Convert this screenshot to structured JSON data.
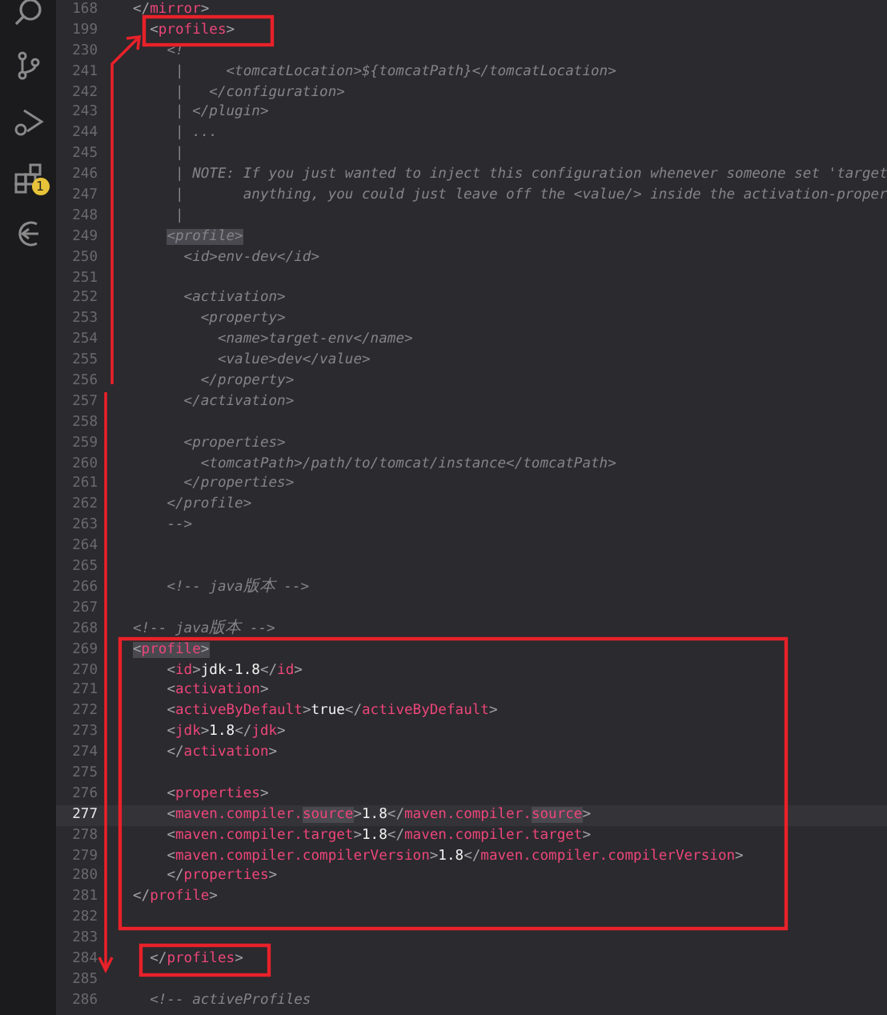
{
  "activity_bar": {
    "items": [
      {
        "kind": "search"
      },
      {
        "kind": "branch"
      },
      {
        "kind": "run"
      },
      {
        "kind": "extensions",
        "badge_text": "1"
      },
      {
        "kind": "arc"
      }
    ]
  },
  "editor": {
    "lines": [
      {
        "number": "168",
        "current": false,
        "segments": [
          {
            "kind": "bracket",
            "text": "</"
          },
          {
            "kind": "tag",
            "text": "mirror"
          },
          {
            "kind": "bracket",
            "text": ">"
          }
        ]
      },
      {
        "number": "199",
        "current": false,
        "segments": [
          {
            "kind": "bracket",
            "text": "  <"
          },
          {
            "kind": "tag",
            "text": "profiles"
          },
          {
            "kind": "bracket",
            "text": ">"
          }
        ]
      },
      {
        "number": "230",
        "current": false,
        "segments": [
          {
            "kind": "comment",
            "text": "    <!"
          }
        ]
      },
      {
        "number": "241",
        "current": false,
        "segments": [
          {
            "kind": "comment",
            "text": "     |     <tomcatLocation>${tomcatPath}</tomcatLocation>"
          }
        ]
      },
      {
        "number": "242",
        "current": false,
        "segments": [
          {
            "kind": "comment",
            "text": "     |   </configuration>"
          }
        ]
      },
      {
        "number": "243",
        "current": false,
        "segments": [
          {
            "kind": "comment",
            "text": "     | </plugin>"
          }
        ]
      },
      {
        "number": "244",
        "current": false,
        "segments": [
          {
            "kind": "comment",
            "text": "     | ..."
          }
        ]
      },
      {
        "number": "245",
        "current": false,
        "segments": [
          {
            "kind": "comment",
            "text": "     |"
          }
        ]
      },
      {
        "number": "246",
        "current": false,
        "segments": [
          {
            "kind": "comment",
            "text": "     | NOTE: If you just wanted to inject this configuration whenever someone set 'target"
          }
        ]
      },
      {
        "number": "247",
        "current": false,
        "segments": [
          {
            "kind": "comment",
            "text": "     |       anything, you could just leave off the <value/> inside the activation-proper"
          }
        ]
      },
      {
        "number": "248",
        "current": false,
        "segments": [
          {
            "kind": "comment",
            "text": "     |"
          }
        ]
      },
      {
        "number": "249",
        "current": false,
        "segments": [
          {
            "kind": "comment-match",
            "text": "    <profile>"
          }
        ]
      },
      {
        "number": "250",
        "current": false,
        "segments": [
          {
            "kind": "comment",
            "text": "      <id>env-dev</id>"
          }
        ]
      },
      {
        "number": "251",
        "current": false
      },
      {
        "number": "252",
        "current": false,
        "segments": [
          {
            "kind": "comment",
            "text": "      <activation>"
          }
        ]
      },
      {
        "number": "253",
        "current": false,
        "segments": [
          {
            "kind": "comment",
            "text": "        <property>"
          }
        ]
      },
      {
        "number": "254",
        "current": false,
        "segments": [
          {
            "kind": "comment",
            "text": "          <name>target-env</name>"
          }
        ]
      },
      {
        "number": "255",
        "current": false,
        "segments": [
          {
            "kind": "comment",
            "text": "          <value>dev</value>"
          }
        ]
      },
      {
        "number": "256",
        "current": false,
        "segments": [
          {
            "kind": "comment",
            "text": "        </property>"
          }
        ]
      },
      {
        "number": "257",
        "current": false,
        "segments": [
          {
            "kind": "comment",
            "text": "      </activation>"
          }
        ]
      },
      {
        "number": "258",
        "current": false
      },
      {
        "number": "259",
        "current": false,
        "segments": [
          {
            "kind": "comment",
            "text": "      <properties>"
          }
        ]
      },
      {
        "number": "260",
        "current": false,
        "segments": [
          {
            "kind": "comment",
            "text": "        <tomcatPath>/path/to/tomcat/instance</tomcatPath>"
          }
        ]
      },
      {
        "number": "261",
        "current": false,
        "segments": [
          {
            "kind": "comment",
            "text": "      </properties>"
          }
        ]
      },
      {
        "number": "262",
        "current": false,
        "segments": [
          {
            "kind": "comment",
            "text": "    </profile>"
          }
        ]
      },
      {
        "number": "263",
        "current": false,
        "segments": [
          {
            "kind": "comment",
            "text": "    -->"
          }
        ]
      },
      {
        "number": "264",
        "current": false
      },
      {
        "number": "265",
        "current": false
      },
      {
        "number": "266",
        "current": false,
        "segments": [
          {
            "kind": "comment",
            "text": "    <!-- java"
          },
          {
            "kind": "comment-cjk",
            "text": "版本"
          },
          {
            "kind": "comment",
            "text": " -->"
          }
        ]
      },
      {
        "number": "267",
        "current": false
      },
      {
        "number": "268",
        "current": false,
        "segments": [
          {
            "kind": "comment",
            "text": "<!-- java"
          },
          {
            "kind": "comment-cjk",
            "text": "版本"
          },
          {
            "kind": "comment",
            "text": " -->"
          }
        ]
      },
      {
        "number": "269",
        "current": false,
        "segments": [
          {
            "kind": "bracket-match",
            "text": "<"
          },
          {
            "kind": "tag-match",
            "text": "profile"
          },
          {
            "kind": "bracket-match",
            "text": ">"
          }
        ]
      },
      {
        "number": "270",
        "current": false,
        "segments": [
          {
            "kind": "bracket",
            "text": "    <"
          },
          {
            "kind": "tag",
            "text": "id"
          },
          {
            "kind": "bracket",
            "text": ">"
          },
          {
            "kind": "text",
            "text": "jdk-1.8"
          },
          {
            "kind": "bracket",
            "text": "</"
          },
          {
            "kind": "tag",
            "text": "id"
          },
          {
            "kind": "bracket",
            "text": ">"
          }
        ]
      },
      {
        "number": "271",
        "current": false,
        "segments": [
          {
            "kind": "bracket",
            "text": "    <"
          },
          {
            "kind": "tag",
            "text": "activation"
          },
          {
            "kind": "bracket",
            "text": ">"
          }
        ]
      },
      {
        "number": "272",
        "current": false,
        "segments": [
          {
            "kind": "bracket",
            "text": "    <"
          },
          {
            "kind": "tag",
            "text": "activeByDefault"
          },
          {
            "kind": "bracket",
            "text": ">"
          },
          {
            "kind": "text",
            "text": "true"
          },
          {
            "kind": "bracket",
            "text": "</"
          },
          {
            "kind": "tag",
            "text": "activeByDefault"
          },
          {
            "kind": "bracket",
            "text": ">"
          }
        ]
      },
      {
        "number": "273",
        "current": false,
        "segments": [
          {
            "kind": "bracket",
            "text": "    <"
          },
          {
            "kind": "tag",
            "text": "jdk"
          },
          {
            "kind": "bracket",
            "text": ">"
          },
          {
            "kind": "text",
            "text": "1.8"
          },
          {
            "kind": "bracket",
            "text": "</"
          },
          {
            "kind": "tag",
            "text": "jdk"
          },
          {
            "kind": "bracket",
            "text": ">"
          }
        ]
      },
      {
        "number": "274",
        "current": false,
        "segments": [
          {
            "kind": "bracket",
            "text": "    </"
          },
          {
            "kind": "tag",
            "text": "activation"
          },
          {
            "kind": "bracket",
            "text": ">"
          }
        ]
      },
      {
        "number": "275",
        "current": false
      },
      {
        "number": "276",
        "current": false,
        "segments": [
          {
            "kind": "bracket",
            "text": "    <"
          },
          {
            "kind": "tag",
            "text": "properties"
          },
          {
            "kind": "bracket",
            "text": ">"
          }
        ]
      },
      {
        "number": "277",
        "current": true,
        "segments": [
          {
            "kind": "bracket",
            "text": "    <"
          },
          {
            "kind": "tag",
            "text": "maven.compiler."
          },
          {
            "kind": "tag-match",
            "text": "source"
          },
          {
            "kind": "bracket",
            "text": ">"
          },
          {
            "kind": "text",
            "text": "1.8"
          },
          {
            "kind": "bracket",
            "text": "</"
          },
          {
            "kind": "tag",
            "text": "maven.compiler."
          },
          {
            "kind": "tag-match",
            "text": "source"
          },
          {
            "kind": "bracket",
            "text": ">"
          }
        ]
      },
      {
        "number": "278",
        "current": false,
        "segments": [
          {
            "kind": "bracket",
            "text": "    <"
          },
          {
            "kind": "tag",
            "text": "maven.compiler.target"
          },
          {
            "kind": "bracket",
            "text": ">"
          },
          {
            "kind": "text",
            "text": "1.8"
          },
          {
            "kind": "bracket",
            "text": "</"
          },
          {
            "kind": "tag",
            "text": "maven.compiler.target"
          },
          {
            "kind": "bracket",
            "text": ">"
          }
        ]
      },
      {
        "number": "279",
        "current": false,
        "segments": [
          {
            "kind": "bracket",
            "text": "    <"
          },
          {
            "kind": "tag",
            "text": "maven.compiler.compilerVersion"
          },
          {
            "kind": "bracket",
            "text": ">"
          },
          {
            "kind": "text",
            "text": "1.8"
          },
          {
            "kind": "bracket",
            "text": "</"
          },
          {
            "kind": "tag",
            "text": "maven.compiler.compilerVersion"
          },
          {
            "kind": "bracket",
            "text": ">"
          }
        ]
      },
      {
        "number": "280",
        "current": false,
        "segments": [
          {
            "kind": "bracket",
            "text": "    </"
          },
          {
            "kind": "tag",
            "text": "properties"
          },
          {
            "kind": "bracket",
            "text": ">"
          }
        ]
      },
      {
        "number": "281",
        "current": false,
        "segments": [
          {
            "kind": "bracket",
            "text": "</"
          },
          {
            "kind": "tag",
            "text": "profile"
          },
          {
            "kind": "bracket",
            "text": ">"
          }
        ]
      },
      {
        "number": "282",
        "current": false
      },
      {
        "number": "283",
        "current": false
      },
      {
        "number": "284",
        "current": false,
        "segments": [
          {
            "kind": "bracket",
            "text": "  </"
          },
          {
            "kind": "tag",
            "text": "profiles"
          },
          {
            "kind": "bracket",
            "text": ">"
          }
        ]
      },
      {
        "number": "285",
        "current": false
      },
      {
        "number": "286",
        "current": false,
        "segments": [
          {
            "kind": "comment",
            "text": "  <!-- activeProfiles"
          }
        ]
      }
    ]
  }
}
